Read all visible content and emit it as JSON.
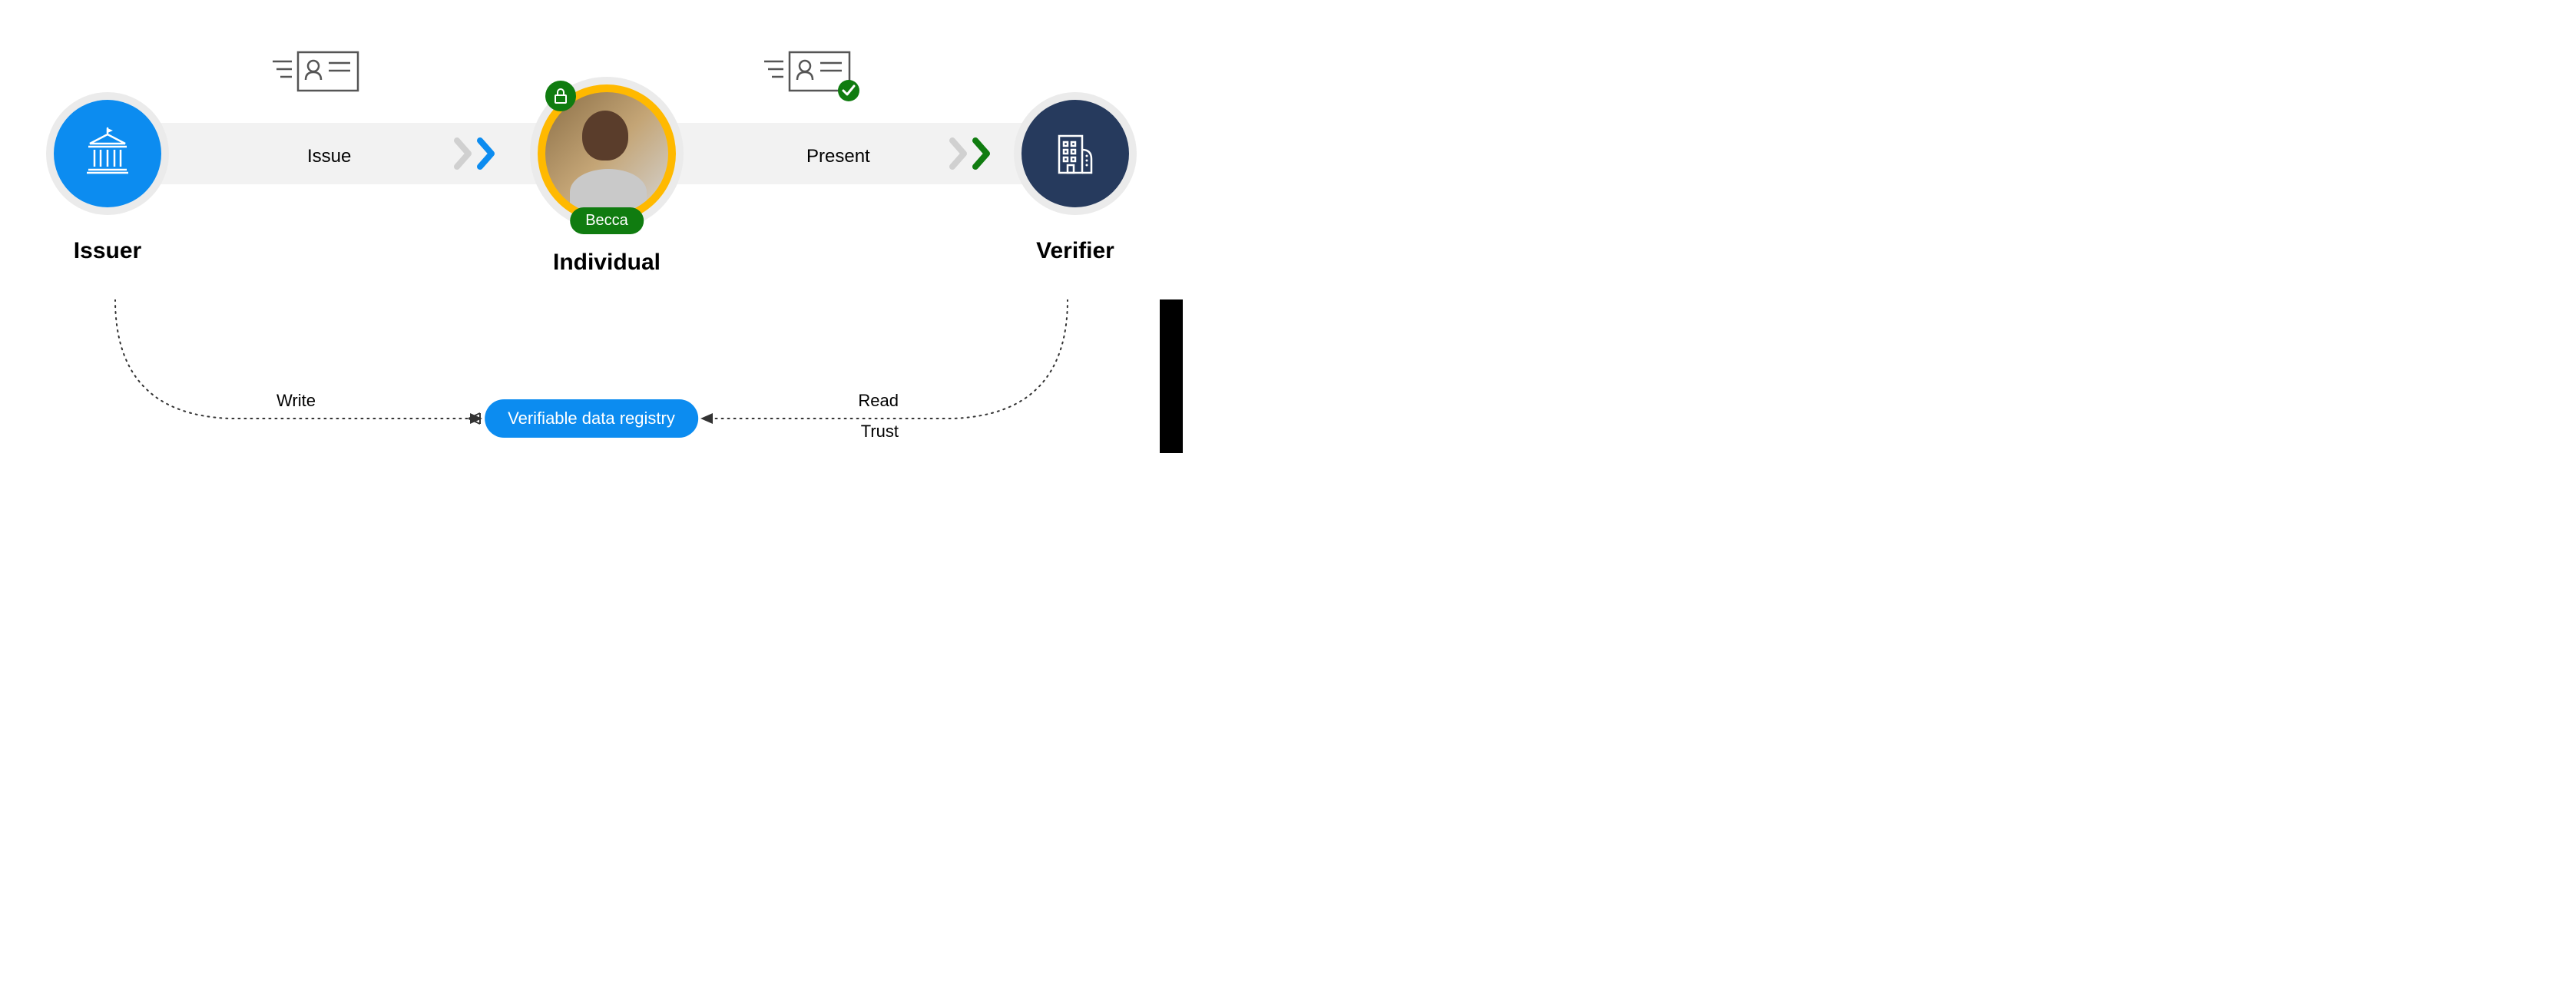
{
  "entities": {
    "issuer": {
      "label": "Issuer"
    },
    "individual": {
      "label": "Individual",
      "name": "Becca"
    },
    "verifier": {
      "label": "Verifier"
    }
  },
  "actions": {
    "issue": "Issue",
    "present": "Present"
  },
  "registry": {
    "label": "Verifiable data registry"
  },
  "paths": {
    "write": "Write",
    "read": "Read",
    "trust": "Trust"
  },
  "colors": {
    "blue": "#0c8cf0",
    "navy": "#263a5d",
    "green": "#107c10",
    "yellow": "#ffb900",
    "grey": "#f2f2f2"
  }
}
